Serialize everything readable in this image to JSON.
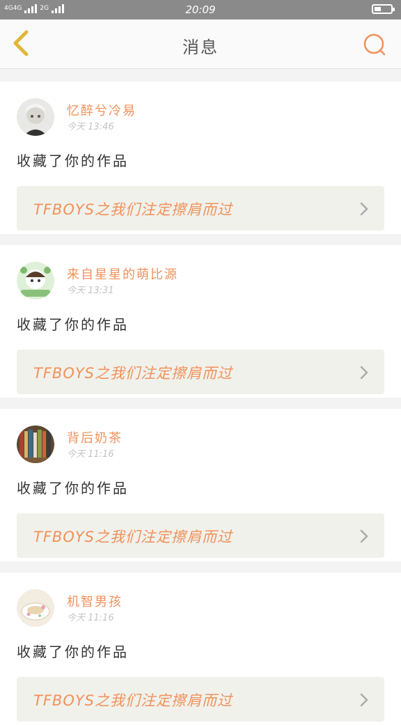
{
  "status_bar": {
    "network": "4G4G",
    "network_2": "2G",
    "time": "20:09"
  },
  "nav": {
    "title": "消息",
    "back_icon": "chevron-left-icon",
    "search_icon": "search-icon"
  },
  "colors": {
    "accent": "#f0915a",
    "back_icon": "#e0b73a",
    "card_link_bg": "#f1f1ec",
    "status_bar": "#8a8a8a"
  },
  "messages": [
    {
      "username": "忆醉兮冷易",
      "time": "今天 13:46",
      "action": "收藏了你的作品",
      "work_title": "TFBOYS之我们注定擦肩而过",
      "avatar": "anime-boy"
    },
    {
      "username": "来自星星的萌比源",
      "time": "今天 13:31",
      "action": "收藏了你的作品",
      "work_title": "TFBOYS之我们注定擦肩而过",
      "avatar": "cartoon-green"
    },
    {
      "username": "背后奶茶",
      "time": "今天 11:16",
      "action": "收藏了你的作品",
      "work_title": "TFBOYS之我们注定擦肩而过",
      "avatar": "bookshelf"
    },
    {
      "username": "机智男孩",
      "time": "今天 11:16",
      "action": "收藏了你的作品",
      "work_title": "TFBOYS之我们注定擦肩而过",
      "avatar": "teacup"
    }
  ]
}
